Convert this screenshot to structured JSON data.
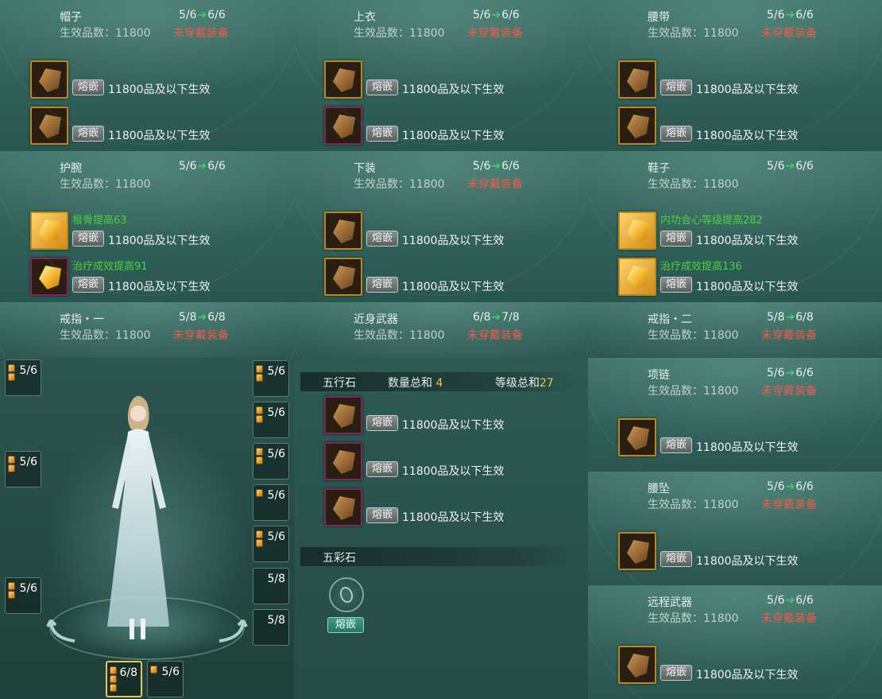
{
  "panels": [
    {
      "title": "帽子",
      "count_from": "5/6",
      "count_to": "6/6",
      "level": "生效品数：11800",
      "status": "未穿戴装备",
      "sockets": [
        {
          "style": "brown",
          "effect": "",
          "button": "熔嵌",
          "text": "11800品及以下生效"
        },
        {
          "style": "brown",
          "effect": "",
          "button": "熔嵌",
          "text": "11800品及以下生效"
        }
      ]
    },
    {
      "title": "上衣",
      "count_from": "5/6",
      "count_to": "6/6",
      "level": "生效品数：11800",
      "status": "未穿戴装备",
      "sockets": [
        {
          "style": "brown",
          "effect": "",
          "button": "熔嵌",
          "text": "11800品及以下生效"
        },
        {
          "style": "purple",
          "effect": "",
          "button": "熔嵌",
          "text": "11800品及以下生效"
        }
      ]
    },
    {
      "title": "腰带",
      "count_from": "5/6",
      "count_to": "6/6",
      "level": "生效品数：11800",
      "status": "未穿戴装备",
      "sockets": [
        {
          "style": "brown",
          "effect": "",
          "button": "熔嵌",
          "text": "11800品及以下生效"
        },
        {
          "style": "brown",
          "effect": "",
          "button": "熔嵌",
          "text": "11800品及以下生效"
        }
      ]
    },
    {
      "title": "护腕",
      "count_from": "5/6",
      "count_to": "6/6",
      "level": "生效品数：11800",
      "status": "",
      "sockets": [
        {
          "style": "gold",
          "effect": "根骨提高63",
          "button": "熔嵌",
          "text": "11800品及以下生效"
        },
        {
          "style": "purple-bright",
          "effect": "治疗成效提高91",
          "button": "熔嵌",
          "text": "11800品及以下生效"
        }
      ]
    },
    {
      "title": "下装",
      "count_from": "5/6",
      "count_to": "6/6",
      "level": "生效品数：11800",
      "status": "未穿戴装备",
      "sockets": [
        {
          "style": "brown",
          "effect": "",
          "button": "熔嵌",
          "text": "11800品及以下生效"
        },
        {
          "style": "brown",
          "effect": "",
          "button": "熔嵌",
          "text": "11800品及以下生效"
        }
      ]
    },
    {
      "title": "鞋子",
      "count_from": "5/6",
      "count_to": "6/6",
      "level": "生效品数：11800",
      "status": "",
      "sockets": [
        {
          "style": "gold",
          "effect": "内功会心等级提高282",
          "button": "熔嵌",
          "text": "11800品及以下生效"
        },
        {
          "style": "gold",
          "effect": "治疗成效提高136",
          "button": "熔嵌",
          "text": "11800品及以下生效"
        }
      ]
    },
    {
      "title": "戒指・一",
      "count_from": "5/8",
      "count_to": "6/8",
      "level": "生效品数：11800",
      "status": "未穿戴装备",
      "sockets": []
    },
    {
      "title": "近身武器",
      "count_from": "6/8",
      "count_to": "7/8",
      "level": "生效品数：11800",
      "status": "未穿戴装备",
      "sockets": []
    },
    {
      "title": "戒指・二",
      "count_from": "5/8",
      "count_to": "6/8",
      "level": "生效品数：11800",
      "status": "未穿戴装备",
      "sockets": []
    },
    {
      "title": "项链",
      "count_from": "5/6",
      "count_to": "6/6",
      "level": "生效品数：11800",
      "status": "未穿戴装备",
      "sockets": [
        {
          "style": "brown",
          "effect": "",
          "button": "熔嵌",
          "text": "11800品及以下生效"
        }
      ]
    },
    {
      "title": "腰坠",
      "count_from": "5/6",
      "count_to": "6/6",
      "level": "生效品数：11800",
      "status": "未穿戴装备",
      "sockets": [
        {
          "style": "brown",
          "effect": "",
          "button": "熔嵌",
          "text": "11800品及以下生效"
        }
      ]
    },
    {
      "title": "远程武器",
      "count_from": "5/6",
      "count_to": "6/6",
      "level": "生效品数：11800",
      "status": "未穿戴装备",
      "sockets": [
        {
          "style": "brown",
          "effect": "",
          "button": "熔嵌",
          "text": "11800品及以下生效"
        }
      ]
    }
  ],
  "character_slots": [
    {
      "value": "5/6",
      "pips": 2
    },
    {
      "value": "5/6",
      "pips": 2
    },
    {
      "value": "5/6",
      "pips": 2
    },
    {
      "value": "5/6",
      "pips": 2
    },
    {
      "value": "5/6",
      "pips": 2
    },
    {
      "value": "5/6",
      "pips": 2
    },
    {
      "value": "5/6",
      "pips": 1
    },
    {
      "value": "5/6",
      "pips": 2
    },
    {
      "value": "5/8",
      "pips": 0
    },
    {
      "value": "5/8",
      "pips": 0
    },
    {
      "value": "6/8",
      "pips": 3
    },
    {
      "value": "5/6",
      "pips": 1
    }
  ],
  "wuxing": {
    "title": "五行石",
    "count_label": "数量总和",
    "count_value": "4",
    "level_label": "等级总和",
    "level_value": "27",
    "sockets": [
      {
        "button": "熔嵌",
        "text": "11800品及以下生效"
      },
      {
        "button": "熔嵌",
        "text": "11800品及以下生效"
      },
      {
        "button": "熔嵌",
        "text": "11800品及以下生效"
      }
    ]
  },
  "wucai": {
    "title": "五彩石",
    "button": "熔嵌"
  }
}
